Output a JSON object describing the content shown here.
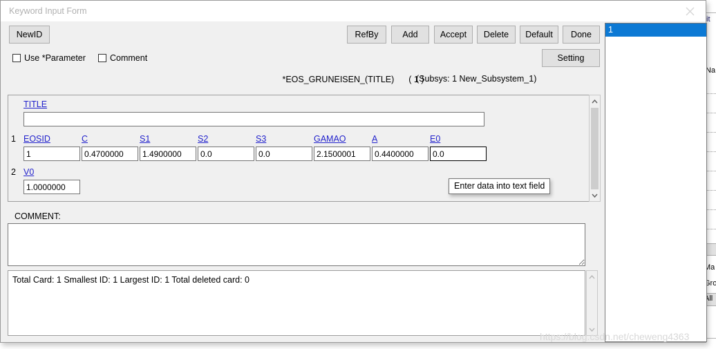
{
  "window": {
    "title": "Keyword Input Form",
    "close_icon": "close-icon"
  },
  "toolbar": {
    "new_id_label": "NewID",
    "buttons": [
      {
        "label": "RefBy"
      },
      {
        "label": "Add"
      },
      {
        "label": "Accept"
      },
      {
        "label": "Delete"
      },
      {
        "label": "Default"
      },
      {
        "label": "Done"
      }
    ],
    "setting_label": "Setting",
    "subsys_label": "(Subsys: 1 New_Subsystem_1)"
  },
  "options": {
    "use_parameter_label": "Use *Parameter",
    "use_parameter_checked": false,
    "comment_label": "Comment",
    "comment_checked": false
  },
  "keyword": {
    "title": "*EOS_GRUNEISEN_(TITLE)",
    "count": "( 1 )"
  },
  "form": {
    "title_field": {
      "label": "TITLE",
      "value": "",
      "placeholder": ""
    },
    "row1": {
      "number": "1",
      "fields": [
        {
          "label": "EOSID",
          "value": "1"
        },
        {
          "label": "C",
          "value": "0.4700000"
        },
        {
          "label": "S1",
          "value": "1.4900000"
        },
        {
          "label": "S2",
          "value": "0.0"
        },
        {
          "label": "S3",
          "value": "0.0"
        },
        {
          "label": "GAMAO",
          "value": "2.1500001"
        },
        {
          "label": "A",
          "value": "0.4400000"
        },
        {
          "label": "E0",
          "value": "0.0"
        }
      ]
    },
    "row2": {
      "number": "2",
      "fields": [
        {
          "label": "V0",
          "value": "1.0000000"
        }
      ]
    }
  },
  "comment": {
    "label": "COMMENT:",
    "value": ""
  },
  "status": {
    "text": "Total Card: 1    Smallest ID: 1   Largest ID: 1   Total deleted card:  0"
  },
  "id_list": {
    "items": [
      {
        "label": "1",
        "selected": true
      }
    ]
  },
  "tooltip": {
    "text": "Enter data into text field"
  },
  "watermark": {
    "text": "https://blog.csdn.net/cheweng4363"
  },
  "colors": {
    "selection_blue": "#0c79d4",
    "field_link": "#2222cc",
    "dialog_bg": "#f0f0f0",
    "button_bg": "#e1e1e1"
  },
  "background_windows": {
    "fragments": [
      {
        "text": "it"
      },
      {
        "text": "Na"
      },
      {
        "text": "Ma"
      },
      {
        "text": "Gro"
      },
      {
        "text": "All"
      }
    ]
  }
}
